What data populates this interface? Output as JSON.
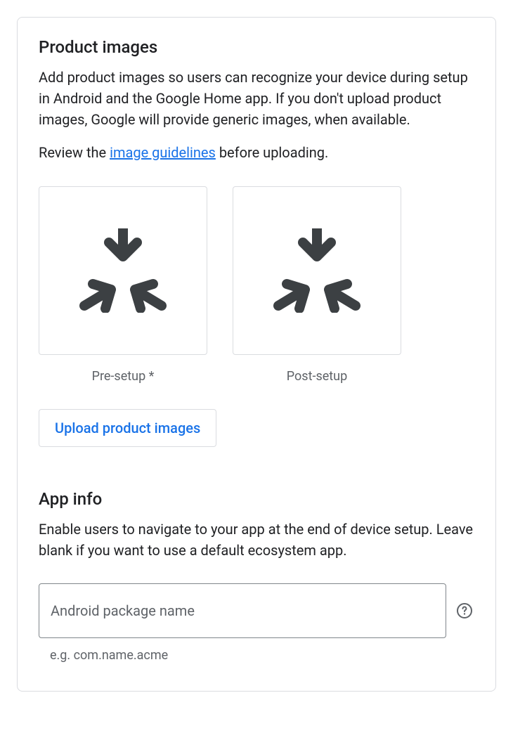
{
  "product_images": {
    "title": "Product images",
    "description": "Add product images so users can recognize your device during setup in Android and the Google Home app. If you don't upload product images, Google will provide generic images, when available.",
    "review_prefix": "Review the ",
    "review_link": "image guidelines",
    "review_suffix": " before uploading.",
    "items": [
      {
        "caption": "Pre-setup *"
      },
      {
        "caption": "Post-setup"
      }
    ],
    "upload_button": "Upload product images"
  },
  "app_info": {
    "title": "App info",
    "description": "Enable users to navigate to your app at the end of device setup. Leave blank if you want to use a default ecosystem app.",
    "input_placeholder": "Android package name",
    "input_value": "",
    "hint": "e.g. com.name.acme"
  }
}
